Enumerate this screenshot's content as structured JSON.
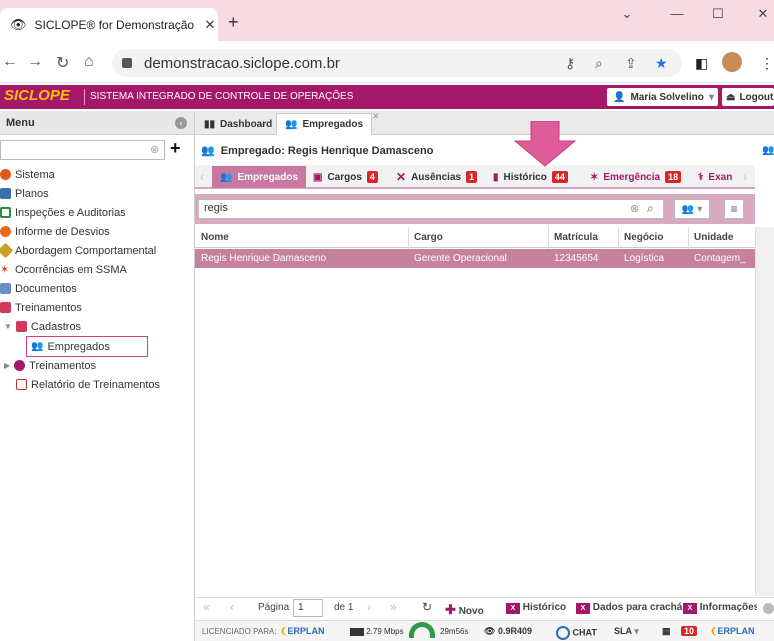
{
  "browser": {
    "tab_title": "SICLOPE® for Demonstração ER",
    "url": "demonstracao.siclope.com.br"
  },
  "app": {
    "logo": "SICLOPE",
    "system_name": "SISTEMA INTEGRADO DE CONTROLE DE OPERAÇÕES",
    "user": "Maria Solvelino",
    "logout": "Logout"
  },
  "menu": {
    "header": "Menu",
    "items": [
      {
        "label": "Sistema",
        "color": "#e05a1c"
      },
      {
        "label": "Planos",
        "color": "#3a6fb0"
      },
      {
        "label": "Inspeções e Auditorias",
        "color": "#2e8b3d"
      },
      {
        "label": "Informe de Desvios",
        "color": "#e86a1a"
      },
      {
        "label": "Abordagem Comportamental",
        "color": "#c9a227"
      },
      {
        "label": "Ocorrências em SSMA",
        "color": "#d84a1b"
      },
      {
        "label": "Documentos",
        "color": "#6a8fc2"
      },
      {
        "label": "Treinamentos",
        "color": "#d43a5a"
      },
      {
        "label": "Cadastros",
        "color": "#d43a5a"
      },
      {
        "label": "Empregados",
        "color": "#a51869"
      },
      {
        "label": "Treinamentos",
        "color": "#a51869"
      },
      {
        "label": "Relatório de Treinamentos",
        "color": "#c0392b"
      }
    ]
  },
  "app_tabs": [
    "Dashboard",
    "Empregados"
  ],
  "panel": {
    "title": "Empregado: Regis Henrique Damasceno"
  },
  "sub_tabs": [
    {
      "label": "Empregados",
      "count": ""
    },
    {
      "label": "Cargos",
      "count": "4"
    },
    {
      "label": "Ausências",
      "count": "1"
    },
    {
      "label": "Histórico",
      "count": "44"
    },
    {
      "label": "Emergência",
      "count": "18"
    },
    {
      "label": "Exan",
      "count": ""
    }
  ],
  "search": {
    "value": "regis"
  },
  "table": {
    "columns": [
      "Nome",
      "Cargo",
      "Matrícula",
      "Negócio",
      "Unidade"
    ],
    "rows": [
      [
        "Regis Henrique Damasceno",
        "Gerente Operacional",
        "12345654",
        "Logística",
        "Contagem_"
      ]
    ]
  },
  "pager": {
    "page_label": "Página",
    "page_value": "1",
    "of_label": "de 1",
    "novo": "Novo",
    "historico": "Histórico",
    "cracha": "Dados para crachá",
    "informacoes": "Informações"
  },
  "footer": {
    "licensed": "LICENCIADO PARA:",
    "brand": "ERPLAN",
    "speed": "2.79 Mbps",
    "time": "29m56s",
    "version": "0.9R409",
    "chat": "CHAT",
    "sla": "SLA",
    "badge": "10",
    "brand2": "ERPLAN"
  }
}
